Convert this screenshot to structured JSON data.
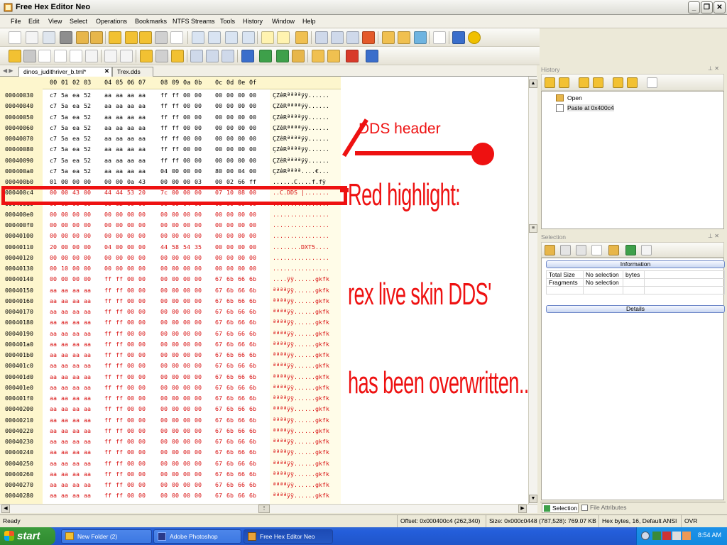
{
  "window": {
    "title": "Free Hex Editor Neo"
  },
  "menu": [
    "File",
    "Edit",
    "View",
    "Select",
    "Operations",
    "Bookmarks",
    "NTFS Streams",
    "Tools",
    "History",
    "Window",
    "Help"
  ],
  "tabs": [
    {
      "label": "dinos_judithriver_b.tml*"
    },
    {
      "label": "Trex.dds"
    }
  ],
  "hex_header": [
    "00",
    "01",
    "02",
    "03",
    "04",
    "05",
    "06",
    "07",
    "08",
    "09",
    "0a",
    "0b",
    "0c",
    "0d",
    "0e",
    "0f"
  ],
  "rows": [
    {
      "off": "00040030",
      "bytes": [
        "c7",
        "5a",
        "ea",
        "52",
        "aa",
        "aa",
        "aa",
        "aa",
        "ff",
        "ff",
        "00",
        "00",
        "00",
        "00",
        "00",
        "00"
      ],
      "ascii": "ÇZêRªªªªÿÿ......",
      "red": false
    },
    {
      "off": "00040040",
      "bytes": [
        "c7",
        "5a",
        "ea",
        "52",
        "aa",
        "aa",
        "aa",
        "aa",
        "ff",
        "ff",
        "00",
        "00",
        "00",
        "00",
        "00",
        "00"
      ],
      "ascii": "ÇZêRªªªªÿÿ......",
      "red": false
    },
    {
      "off": "00040050",
      "bytes": [
        "c7",
        "5a",
        "ea",
        "52",
        "aa",
        "aa",
        "aa",
        "aa",
        "ff",
        "ff",
        "00",
        "00",
        "00",
        "00",
        "00",
        "00"
      ],
      "ascii": "ÇZêRªªªªÿÿ......",
      "red": false
    },
    {
      "off": "00040060",
      "bytes": [
        "c7",
        "5a",
        "ea",
        "52",
        "aa",
        "aa",
        "aa",
        "aa",
        "ff",
        "ff",
        "00",
        "00",
        "00",
        "00",
        "00",
        "00"
      ],
      "ascii": "ÇZêRªªªªÿÿ......",
      "red": false
    },
    {
      "off": "00040070",
      "bytes": [
        "c7",
        "5a",
        "ea",
        "52",
        "aa",
        "aa",
        "aa",
        "aa",
        "ff",
        "ff",
        "00",
        "00",
        "00",
        "00",
        "00",
        "00"
      ],
      "ascii": "ÇZêRªªªªÿÿ......",
      "red": false
    },
    {
      "off": "00040080",
      "bytes": [
        "c7",
        "5a",
        "ea",
        "52",
        "aa",
        "aa",
        "aa",
        "aa",
        "ff",
        "ff",
        "00",
        "00",
        "00",
        "00",
        "00",
        "00"
      ],
      "ascii": "ÇZêRªªªªÿÿ......",
      "red": false
    },
    {
      "off": "00040090",
      "bytes": [
        "c7",
        "5a",
        "ea",
        "52",
        "aa",
        "aa",
        "aa",
        "aa",
        "ff",
        "ff",
        "00",
        "00",
        "00",
        "00",
        "00",
        "00"
      ],
      "ascii": "ÇZêRªªªªÿÿ......",
      "red": false
    },
    {
      "off": "000400a0",
      "bytes": [
        "c7",
        "5a",
        "ea",
        "52",
        "aa",
        "aa",
        "aa",
        "aa",
        "04",
        "00",
        "00",
        "00",
        "80",
        "00",
        "04",
        "00"
      ],
      "ascii": "ÇZêRªªªª....€...",
      "red": false
    },
    {
      "off": "000400b0",
      "bytes": [
        "01",
        "00",
        "00",
        "00",
        "00",
        "00",
        "0a",
        "43",
        "00",
        "00",
        "00",
        "03",
        "00",
        "02",
        "66",
        "ff"
      ],
      "ascii": "......C....f.fÿ",
      "red": false
    },
    {
      "off": "000400c4",
      "bytes": [
        "00",
        "00",
        "43",
        "00",
        "44",
        "44",
        "53",
        "20",
        "7c",
        "00",
        "00",
        "00",
        "07",
        "10",
        "08",
        "00"
      ],
      "ascii": "..C.DDS |.......",
      "red": true
    },
    {
      "off": "000400d0",
      "bytes": [
        "00",
        "02",
        "00",
        "00",
        "00",
        "02",
        "00",
        "00",
        "00",
        "00",
        "04",
        "00",
        "00",
        "00",
        "00",
        "00"
      ],
      "ascii": "................",
      "red": true
    },
    {
      "off": "000400e0",
      "bytes": [
        "00",
        "00",
        "00",
        "00",
        "00",
        "00",
        "00",
        "00",
        "00",
        "00",
        "00",
        "00",
        "00",
        "00",
        "00",
        "00"
      ],
      "ascii": "................",
      "red": true
    },
    {
      "off": "000400f0",
      "bytes": [
        "00",
        "00",
        "00",
        "00",
        "00",
        "00",
        "00",
        "00",
        "00",
        "00",
        "00",
        "00",
        "00",
        "00",
        "00",
        "00"
      ],
      "ascii": "................",
      "red": true
    },
    {
      "off": "00040100",
      "bytes": [
        "00",
        "00",
        "00",
        "00",
        "00",
        "00",
        "00",
        "00",
        "00",
        "00",
        "00",
        "00",
        "00",
        "00",
        "00",
        "00"
      ],
      "ascii": "................",
      "red": true
    },
    {
      "off": "00040110",
      "bytes": [
        "20",
        "00",
        "00",
        "00",
        "04",
        "00",
        "00",
        "00",
        "44",
        "58",
        "54",
        "35",
        "00",
        "00",
        "00",
        "00"
      ],
      "ascii": "........DXT5....",
      "red": true
    },
    {
      "off": "00040120",
      "bytes": [
        "00",
        "00",
        "00",
        "00",
        "00",
        "00",
        "00",
        "00",
        "00",
        "00",
        "00",
        "00",
        "00",
        "00",
        "00",
        "00"
      ],
      "ascii": "................",
      "red": true
    },
    {
      "off": "00040130",
      "bytes": [
        "00",
        "10",
        "00",
        "00",
        "00",
        "00",
        "00",
        "00",
        "00",
        "00",
        "00",
        "00",
        "00",
        "00",
        "00",
        "00"
      ],
      "ascii": "................",
      "red": true
    },
    {
      "off": "00040140",
      "bytes": [
        "00",
        "00",
        "00",
        "00",
        "ff",
        "ff",
        "00",
        "00",
        "00",
        "00",
        "00",
        "00",
        "67",
        "6b",
        "66",
        "6b"
      ],
      "ascii": "....ÿÿ......gkfk",
      "red": true
    },
    {
      "off": "00040150",
      "bytes": [
        "aa",
        "aa",
        "aa",
        "aa",
        "ff",
        "ff",
        "00",
        "00",
        "00",
        "00",
        "00",
        "00",
        "67",
        "6b",
        "66",
        "6b"
      ],
      "ascii": "ªªªªÿÿ......gkfk",
      "red": true
    },
    {
      "off": "00040160",
      "bytes": [
        "aa",
        "aa",
        "aa",
        "aa",
        "ff",
        "ff",
        "00",
        "00",
        "00",
        "00",
        "00",
        "00",
        "67",
        "6b",
        "66",
        "6b"
      ],
      "ascii": "ªªªªÿÿ......gkfk",
      "red": true
    },
    {
      "off": "00040170",
      "bytes": [
        "aa",
        "aa",
        "aa",
        "aa",
        "ff",
        "ff",
        "00",
        "00",
        "00",
        "00",
        "00",
        "00",
        "67",
        "6b",
        "66",
        "6b"
      ],
      "ascii": "ªªªªÿÿ......gkfk",
      "red": true
    },
    {
      "off": "00040180",
      "bytes": [
        "aa",
        "aa",
        "aa",
        "aa",
        "ff",
        "ff",
        "00",
        "00",
        "00",
        "00",
        "00",
        "00",
        "67",
        "6b",
        "66",
        "6b"
      ],
      "ascii": "ªªªªÿÿ......gkfk",
      "red": true
    },
    {
      "off": "00040190",
      "bytes": [
        "aa",
        "aa",
        "aa",
        "aa",
        "ff",
        "ff",
        "00",
        "00",
        "00",
        "00",
        "00",
        "00",
        "67",
        "6b",
        "66",
        "6b"
      ],
      "ascii": "ªªªªÿÿ......gkfk",
      "red": true
    },
    {
      "off": "000401a0",
      "bytes": [
        "aa",
        "aa",
        "aa",
        "aa",
        "ff",
        "ff",
        "00",
        "00",
        "00",
        "00",
        "00",
        "00",
        "67",
        "6b",
        "66",
        "6b"
      ],
      "ascii": "ªªªªÿÿ......gkfk",
      "red": true
    },
    {
      "off": "000401b0",
      "bytes": [
        "aa",
        "aa",
        "aa",
        "aa",
        "ff",
        "ff",
        "00",
        "00",
        "00",
        "00",
        "00",
        "00",
        "67",
        "6b",
        "66",
        "6b"
      ],
      "ascii": "ªªªªÿÿ......gkfk",
      "red": true
    },
    {
      "off": "000401c0",
      "bytes": [
        "aa",
        "aa",
        "aa",
        "aa",
        "ff",
        "ff",
        "00",
        "00",
        "00",
        "00",
        "00",
        "00",
        "67",
        "6b",
        "66",
        "6b"
      ],
      "ascii": "ªªªªÿÿ......gkfk",
      "red": true
    },
    {
      "off": "000401d0",
      "bytes": [
        "aa",
        "aa",
        "aa",
        "aa",
        "ff",
        "ff",
        "00",
        "00",
        "00",
        "00",
        "00",
        "00",
        "67",
        "6b",
        "66",
        "6b"
      ],
      "ascii": "ªªªªÿÿ......gkfk",
      "red": true
    },
    {
      "off": "000401e0",
      "bytes": [
        "aa",
        "aa",
        "aa",
        "aa",
        "ff",
        "ff",
        "00",
        "00",
        "00",
        "00",
        "00",
        "00",
        "67",
        "6b",
        "66",
        "6b"
      ],
      "ascii": "ªªªªÿÿ......gkfk",
      "red": true
    },
    {
      "off": "000401f0",
      "bytes": [
        "aa",
        "aa",
        "aa",
        "aa",
        "ff",
        "ff",
        "00",
        "00",
        "00",
        "00",
        "00",
        "00",
        "67",
        "6b",
        "66",
        "6b"
      ],
      "ascii": "ªªªªÿÿ......gkfk",
      "red": true
    },
    {
      "off": "00040200",
      "bytes": [
        "aa",
        "aa",
        "aa",
        "aa",
        "ff",
        "ff",
        "00",
        "00",
        "00",
        "00",
        "00",
        "00",
        "67",
        "6b",
        "66",
        "6b"
      ],
      "ascii": "ªªªªÿÿ......gkfk",
      "red": true
    },
    {
      "off": "00040210",
      "bytes": [
        "aa",
        "aa",
        "aa",
        "aa",
        "ff",
        "ff",
        "00",
        "00",
        "00",
        "00",
        "00",
        "00",
        "67",
        "6b",
        "66",
        "6b"
      ],
      "ascii": "ªªªªÿÿ......gkfk",
      "red": true
    },
    {
      "off": "00040220",
      "bytes": [
        "aa",
        "aa",
        "aa",
        "aa",
        "ff",
        "ff",
        "00",
        "00",
        "00",
        "00",
        "00",
        "00",
        "67",
        "6b",
        "66",
        "6b"
      ],
      "ascii": "ªªªªÿÿ......gkfk",
      "red": true
    },
    {
      "off": "00040230",
      "bytes": [
        "aa",
        "aa",
        "aa",
        "aa",
        "ff",
        "ff",
        "00",
        "00",
        "00",
        "00",
        "00",
        "00",
        "67",
        "6b",
        "66",
        "6b"
      ],
      "ascii": "ªªªªÿÿ......gkfk",
      "red": true
    },
    {
      "off": "00040240",
      "bytes": [
        "aa",
        "aa",
        "aa",
        "aa",
        "ff",
        "ff",
        "00",
        "00",
        "00",
        "00",
        "00",
        "00",
        "67",
        "6b",
        "66",
        "6b"
      ],
      "ascii": "ªªªªÿÿ......gkfk",
      "red": true
    },
    {
      "off": "00040250",
      "bytes": [
        "aa",
        "aa",
        "aa",
        "aa",
        "ff",
        "ff",
        "00",
        "00",
        "00",
        "00",
        "00",
        "00",
        "67",
        "6b",
        "66",
        "6b"
      ],
      "ascii": "ªªªªÿÿ......gkfk",
      "red": true
    },
    {
      "off": "00040260",
      "bytes": [
        "aa",
        "aa",
        "aa",
        "aa",
        "ff",
        "ff",
        "00",
        "00",
        "00",
        "00",
        "00",
        "00",
        "67",
        "6b",
        "66",
        "6b"
      ],
      "ascii": "ªªªªÿÿ......gkfk",
      "red": true
    },
    {
      "off": "00040270",
      "bytes": [
        "aa",
        "aa",
        "aa",
        "aa",
        "ff",
        "ff",
        "00",
        "00",
        "00",
        "00",
        "00",
        "00",
        "67",
        "6b",
        "66",
        "6b"
      ],
      "ascii": "ªªªªÿÿ......gkfk",
      "red": true
    },
    {
      "off": "00040280",
      "bytes": [
        "aa",
        "aa",
        "aa",
        "aa",
        "ff",
        "ff",
        "00",
        "00",
        "00",
        "00",
        "00",
        "00",
        "67",
        "6b",
        "66",
        "6b"
      ],
      "ascii": "ªªªªÿÿ......gkfk",
      "red": true
    }
  ],
  "annotation": {
    "header_label": "DDS header",
    "lines": [
      "Red highlight:",
      "rex live skin DDS'",
      "has been overwritten..."
    ],
    "color": "#ee1111"
  },
  "history": {
    "title": "History",
    "items": [
      "Open",
      "Paste at 0x400c4"
    ]
  },
  "selection": {
    "title": "Selection",
    "information_label": "Information",
    "details_label": "Details",
    "info_rows": [
      {
        "k": "Total Size",
        "v": "No selection",
        "u": "bytes"
      },
      {
        "k": "Fragments",
        "v": "No selection",
        "u": ""
      }
    ]
  },
  "bottom_tabs": {
    "selection": "Selection",
    "attributes": "File Attributes"
  },
  "status": {
    "ready": "Ready",
    "offset": "Offset: 0x000400c4 (262,340)",
    "size": "Size: 0x000c0448 (787,528): 769.07 KB",
    "mode": "Hex bytes, 16, Default ANSI",
    "ovr": "OVR"
  },
  "taskbar": {
    "start": "start",
    "items": [
      "New Folder (2)",
      "Adobe Photoshop",
      "Free Hex Editor Neo"
    ],
    "clock": "8:54 AM"
  }
}
